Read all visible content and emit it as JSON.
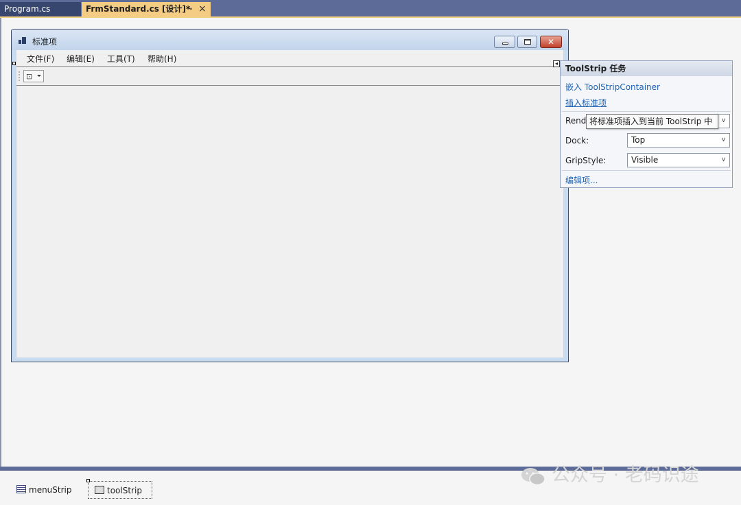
{
  "tabs": [
    {
      "label": "Program.cs",
      "active": false
    },
    {
      "label": "FrmStandard.cs [设计]*",
      "active": true,
      "pin": "⊸",
      "close": "×"
    }
  ],
  "form": {
    "title": "标准项",
    "menu": [
      "文件(F)",
      "编辑(E)",
      "工具(T)",
      "帮助(H)"
    ],
    "close_glyph": "✕"
  },
  "smart_tag": {
    "header": "ToolStrip 任务",
    "embed_link": "嵌入 ToolStripContainer",
    "insert_link": "插入标准项",
    "render_label": "Rend",
    "dock_label": "Dock:",
    "dock_value": "Top",
    "grip_label": "GripStyle:",
    "grip_value": "Visible",
    "edit_link": "编辑项...",
    "tooltip": "将标准项插入到当前 ToolStrip 中"
  },
  "tray": [
    {
      "label": "menuStrip",
      "icon": "menustrip-icon"
    },
    {
      "label": "toolStrip",
      "icon": "toolstrip-icon"
    }
  ],
  "watermark": "公众号 · 老码识途",
  "colors": {
    "tab_bar": "#5d6b99",
    "active_tab": "#f5cc84",
    "link": "#1f63b5"
  }
}
